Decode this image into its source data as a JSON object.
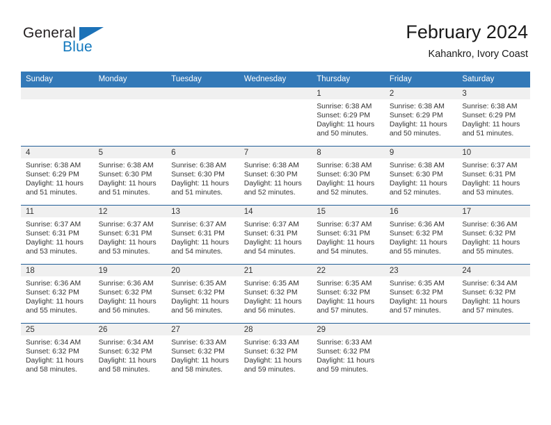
{
  "brand": {
    "word_one": "General",
    "word_two": "Blue",
    "triangle_icon": "triangle-icon",
    "accent_color": "#1c72b8"
  },
  "header": {
    "month_title": "February 2024",
    "location": "Kahankro, Ivory Coast"
  },
  "calendar": {
    "header_bg": "#3379b8",
    "row_divider_color": "#1f5c96",
    "daynum_band_bg": "#f0f0f0",
    "weekday_headers": [
      "Sunday",
      "Monday",
      "Tuesday",
      "Wednesday",
      "Thursday",
      "Friday",
      "Saturday"
    ],
    "weeks": [
      [
        {
          "day": "",
          "sunrise": "",
          "sunset": "",
          "daylight_line1": "",
          "daylight_line2": ""
        },
        {
          "day": "",
          "sunrise": "",
          "sunset": "",
          "daylight_line1": "",
          "daylight_line2": ""
        },
        {
          "day": "",
          "sunrise": "",
          "sunset": "",
          "daylight_line1": "",
          "daylight_line2": ""
        },
        {
          "day": "",
          "sunrise": "",
          "sunset": "",
          "daylight_line1": "",
          "daylight_line2": ""
        },
        {
          "day": "1",
          "sunrise": "Sunrise: 6:38 AM",
          "sunset": "Sunset: 6:29 PM",
          "daylight_line1": "Daylight: 11 hours",
          "daylight_line2": "and 50 minutes."
        },
        {
          "day": "2",
          "sunrise": "Sunrise: 6:38 AM",
          "sunset": "Sunset: 6:29 PM",
          "daylight_line1": "Daylight: 11 hours",
          "daylight_line2": "and 50 minutes."
        },
        {
          "day": "3",
          "sunrise": "Sunrise: 6:38 AM",
          "sunset": "Sunset: 6:29 PM",
          "daylight_line1": "Daylight: 11 hours",
          "daylight_line2": "and 51 minutes."
        }
      ],
      [
        {
          "day": "4",
          "sunrise": "Sunrise: 6:38 AM",
          "sunset": "Sunset: 6:29 PM",
          "daylight_line1": "Daylight: 11 hours",
          "daylight_line2": "and 51 minutes."
        },
        {
          "day": "5",
          "sunrise": "Sunrise: 6:38 AM",
          "sunset": "Sunset: 6:30 PM",
          "daylight_line1": "Daylight: 11 hours",
          "daylight_line2": "and 51 minutes."
        },
        {
          "day": "6",
          "sunrise": "Sunrise: 6:38 AM",
          "sunset": "Sunset: 6:30 PM",
          "daylight_line1": "Daylight: 11 hours",
          "daylight_line2": "and 51 minutes."
        },
        {
          "day": "7",
          "sunrise": "Sunrise: 6:38 AM",
          "sunset": "Sunset: 6:30 PM",
          "daylight_line1": "Daylight: 11 hours",
          "daylight_line2": "and 52 minutes."
        },
        {
          "day": "8",
          "sunrise": "Sunrise: 6:38 AM",
          "sunset": "Sunset: 6:30 PM",
          "daylight_line1": "Daylight: 11 hours",
          "daylight_line2": "and 52 minutes."
        },
        {
          "day": "9",
          "sunrise": "Sunrise: 6:38 AM",
          "sunset": "Sunset: 6:30 PM",
          "daylight_line1": "Daylight: 11 hours",
          "daylight_line2": "and 52 minutes."
        },
        {
          "day": "10",
          "sunrise": "Sunrise: 6:37 AM",
          "sunset": "Sunset: 6:31 PM",
          "daylight_line1": "Daylight: 11 hours",
          "daylight_line2": "and 53 minutes."
        }
      ],
      [
        {
          "day": "11",
          "sunrise": "Sunrise: 6:37 AM",
          "sunset": "Sunset: 6:31 PM",
          "daylight_line1": "Daylight: 11 hours",
          "daylight_line2": "and 53 minutes."
        },
        {
          "day": "12",
          "sunrise": "Sunrise: 6:37 AM",
          "sunset": "Sunset: 6:31 PM",
          "daylight_line1": "Daylight: 11 hours",
          "daylight_line2": "and 53 minutes."
        },
        {
          "day": "13",
          "sunrise": "Sunrise: 6:37 AM",
          "sunset": "Sunset: 6:31 PM",
          "daylight_line1": "Daylight: 11 hours",
          "daylight_line2": "and 54 minutes."
        },
        {
          "day": "14",
          "sunrise": "Sunrise: 6:37 AM",
          "sunset": "Sunset: 6:31 PM",
          "daylight_line1": "Daylight: 11 hours",
          "daylight_line2": "and 54 minutes."
        },
        {
          "day": "15",
          "sunrise": "Sunrise: 6:37 AM",
          "sunset": "Sunset: 6:31 PM",
          "daylight_line1": "Daylight: 11 hours",
          "daylight_line2": "and 54 minutes."
        },
        {
          "day": "16",
          "sunrise": "Sunrise: 6:36 AM",
          "sunset": "Sunset: 6:32 PM",
          "daylight_line1": "Daylight: 11 hours",
          "daylight_line2": "and 55 minutes."
        },
        {
          "day": "17",
          "sunrise": "Sunrise: 6:36 AM",
          "sunset": "Sunset: 6:32 PM",
          "daylight_line1": "Daylight: 11 hours",
          "daylight_line2": "and 55 minutes."
        }
      ],
      [
        {
          "day": "18",
          "sunrise": "Sunrise: 6:36 AM",
          "sunset": "Sunset: 6:32 PM",
          "daylight_line1": "Daylight: 11 hours",
          "daylight_line2": "and 55 minutes."
        },
        {
          "day": "19",
          "sunrise": "Sunrise: 6:36 AM",
          "sunset": "Sunset: 6:32 PM",
          "daylight_line1": "Daylight: 11 hours",
          "daylight_line2": "and 56 minutes."
        },
        {
          "day": "20",
          "sunrise": "Sunrise: 6:35 AM",
          "sunset": "Sunset: 6:32 PM",
          "daylight_line1": "Daylight: 11 hours",
          "daylight_line2": "and 56 minutes."
        },
        {
          "day": "21",
          "sunrise": "Sunrise: 6:35 AM",
          "sunset": "Sunset: 6:32 PM",
          "daylight_line1": "Daylight: 11 hours",
          "daylight_line2": "and 56 minutes."
        },
        {
          "day": "22",
          "sunrise": "Sunrise: 6:35 AM",
          "sunset": "Sunset: 6:32 PM",
          "daylight_line1": "Daylight: 11 hours",
          "daylight_line2": "and 57 minutes."
        },
        {
          "day": "23",
          "sunrise": "Sunrise: 6:35 AM",
          "sunset": "Sunset: 6:32 PM",
          "daylight_line1": "Daylight: 11 hours",
          "daylight_line2": "and 57 minutes."
        },
        {
          "day": "24",
          "sunrise": "Sunrise: 6:34 AM",
          "sunset": "Sunset: 6:32 PM",
          "daylight_line1": "Daylight: 11 hours",
          "daylight_line2": "and 57 minutes."
        }
      ],
      [
        {
          "day": "25",
          "sunrise": "Sunrise: 6:34 AM",
          "sunset": "Sunset: 6:32 PM",
          "daylight_line1": "Daylight: 11 hours",
          "daylight_line2": "and 58 minutes."
        },
        {
          "day": "26",
          "sunrise": "Sunrise: 6:34 AM",
          "sunset": "Sunset: 6:32 PM",
          "daylight_line1": "Daylight: 11 hours",
          "daylight_line2": "and 58 minutes."
        },
        {
          "day": "27",
          "sunrise": "Sunrise: 6:33 AM",
          "sunset": "Sunset: 6:32 PM",
          "daylight_line1": "Daylight: 11 hours",
          "daylight_line2": "and 58 minutes."
        },
        {
          "day": "28",
          "sunrise": "Sunrise: 6:33 AM",
          "sunset": "Sunset: 6:32 PM",
          "daylight_line1": "Daylight: 11 hours",
          "daylight_line2": "and 59 minutes."
        },
        {
          "day": "29",
          "sunrise": "Sunrise: 6:33 AM",
          "sunset": "Sunset: 6:32 PM",
          "daylight_line1": "Daylight: 11 hours",
          "daylight_line2": "and 59 minutes."
        },
        {
          "day": "",
          "sunrise": "",
          "sunset": "",
          "daylight_line1": "",
          "daylight_line2": ""
        },
        {
          "day": "",
          "sunrise": "",
          "sunset": "",
          "daylight_line1": "",
          "daylight_line2": ""
        }
      ]
    ]
  }
}
